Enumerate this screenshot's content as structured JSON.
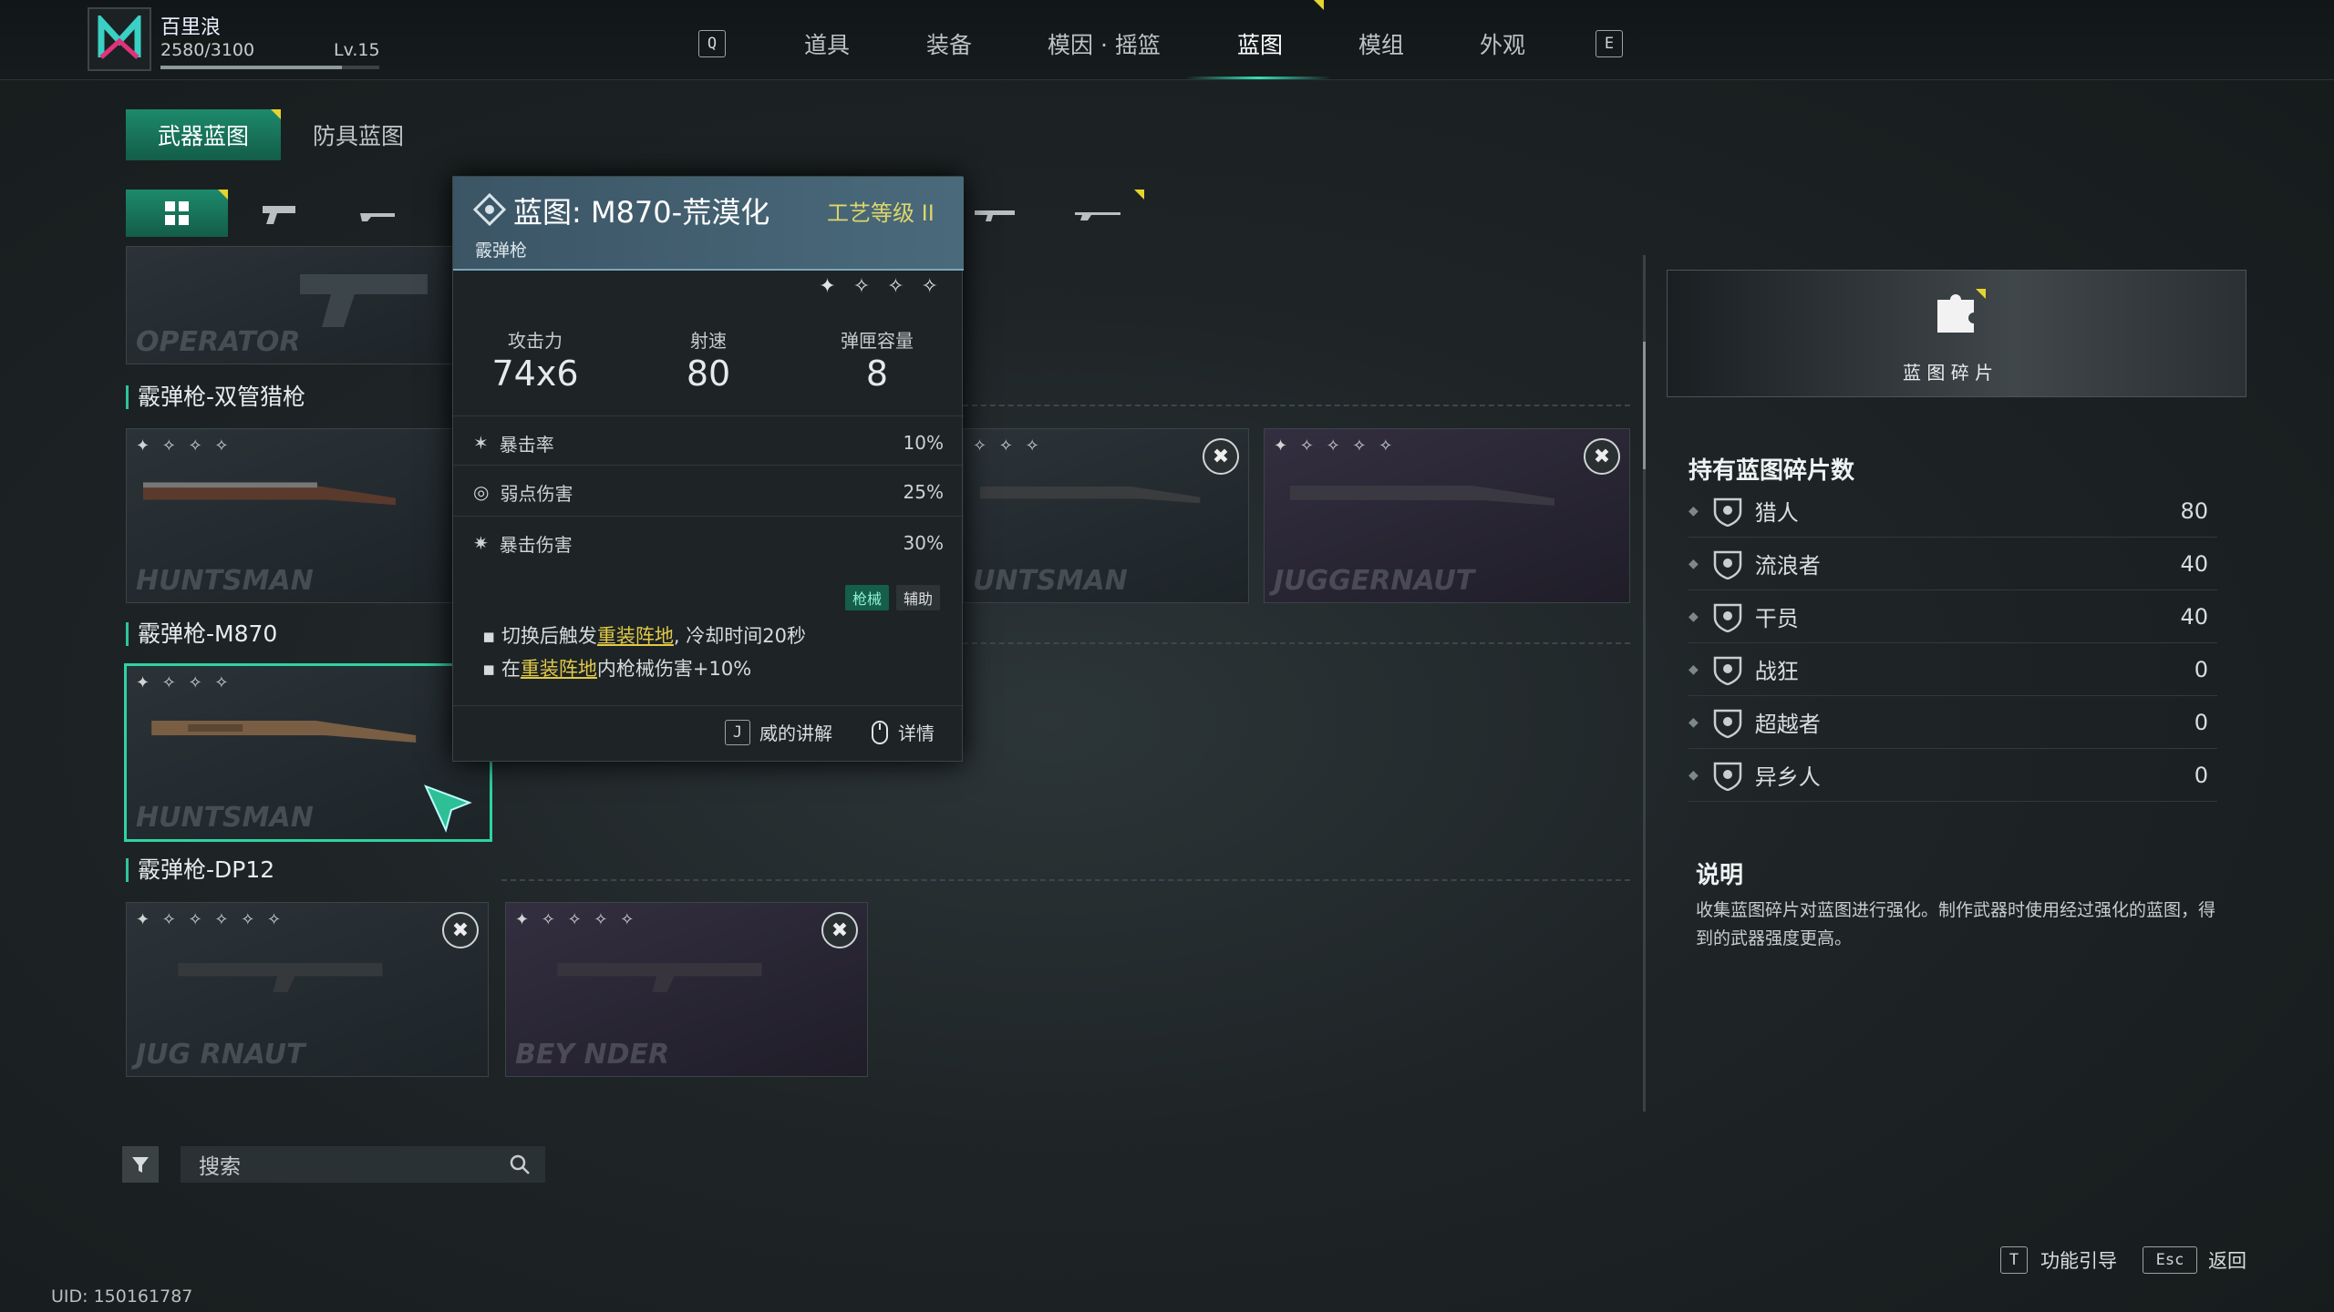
{
  "player": {
    "name": "百里浪",
    "xp": "2580/3100",
    "level": "Lv.15",
    "xp_fraction": 0.83
  },
  "nav": {
    "left_key": "Q",
    "right_key": "E",
    "items": [
      "道具",
      "装备",
      "模因 · 摇篮",
      "蓝图",
      "模组",
      "外观"
    ],
    "active_index": 3
  },
  "subtabs": {
    "weapon": "武器蓝图",
    "armor": "防具蓝图"
  },
  "sections": [
    {
      "title": "霰弹枪-双管猎枪"
    },
    {
      "title": "霰弹枪-M870"
    },
    {
      "title": "霰弹枪-DP12"
    }
  ],
  "cards": {
    "op": {
      "name": "OPERATOR"
    },
    "s1": {
      "name": "HUNTSMAN",
      "stars": "✦ ✧ ✧ ✧"
    },
    "s2": {
      "name": "UNTSMAN",
      "stars": "✧ ✧ ✧"
    },
    "s3": {
      "name": "JUGGERNAUT",
      "stars": "✦ ✧ ✧ ✧ ✧"
    },
    "m1": {
      "name": "HUNTSMAN",
      "stars": "✦ ✧ ✧ ✧"
    },
    "d1": {
      "name": "JUG   RNAUT",
      "stars": "✦ ✧ ✧ ✧ ✧ ✧"
    },
    "d2": {
      "name": "BEY   NDER",
      "stars": "✦ ✧ ✧ ✧ ✧"
    }
  },
  "popup": {
    "title": "蓝图: M870-荒漠化",
    "grade": "工艺等级 II",
    "subtitle": "霰弹枪",
    "rating": "✦ ✧ ✧ ✧",
    "stats": [
      {
        "label": "攻击力",
        "value": "74x6"
      },
      {
        "label": "射速",
        "value": "80"
      },
      {
        "label": "弹匣容量",
        "value": "8"
      }
    ],
    "props": [
      {
        "label": "暴击率",
        "value": "10%"
      },
      {
        "label": "弱点伤害",
        "value": "25%"
      },
      {
        "label": "暴击伤害",
        "value": "30%"
      }
    ],
    "tags": [
      "枪械",
      "辅助"
    ],
    "effect1": {
      "pre": "切换后触发",
      "hl": "重装阵地",
      "post": ", 冷却时间20秒"
    },
    "effect2": {
      "pre": "在",
      "hl": "重装阵地",
      "post": "内枪械伤害+10%"
    },
    "btn_key": "J",
    "btn_label": "威的讲解",
    "detail_label": "详情"
  },
  "banner": {
    "label": "蓝 图 碎 片"
  },
  "fragments": {
    "title": "持有蓝图碎片数",
    "rows": [
      {
        "name": "猎人",
        "count": "80"
      },
      {
        "name": "流浪者",
        "count": "40"
      },
      {
        "name": "干员",
        "count": "40"
      },
      {
        "name": "战狂",
        "count": "0"
      },
      {
        "name": "超越者",
        "count": "0"
      },
      {
        "name": "异乡人",
        "count": "0"
      }
    ]
  },
  "desc": {
    "title": "说明",
    "text": "收集蓝图碎片对蓝图进行强化。制作武器时使用经过强化的蓝图，得到的武器强度更高。"
  },
  "search": {
    "placeholder": "搜索"
  },
  "footer": {
    "guide_key": "T",
    "guide_label": "功能引导",
    "back_key": "Esc",
    "back_label": "返回",
    "uid": "UID: 150161787"
  },
  "colors": {
    "accent": "#2ec49b",
    "highlight": "#e0ca46",
    "popup_header": "#4a6a7c"
  }
}
